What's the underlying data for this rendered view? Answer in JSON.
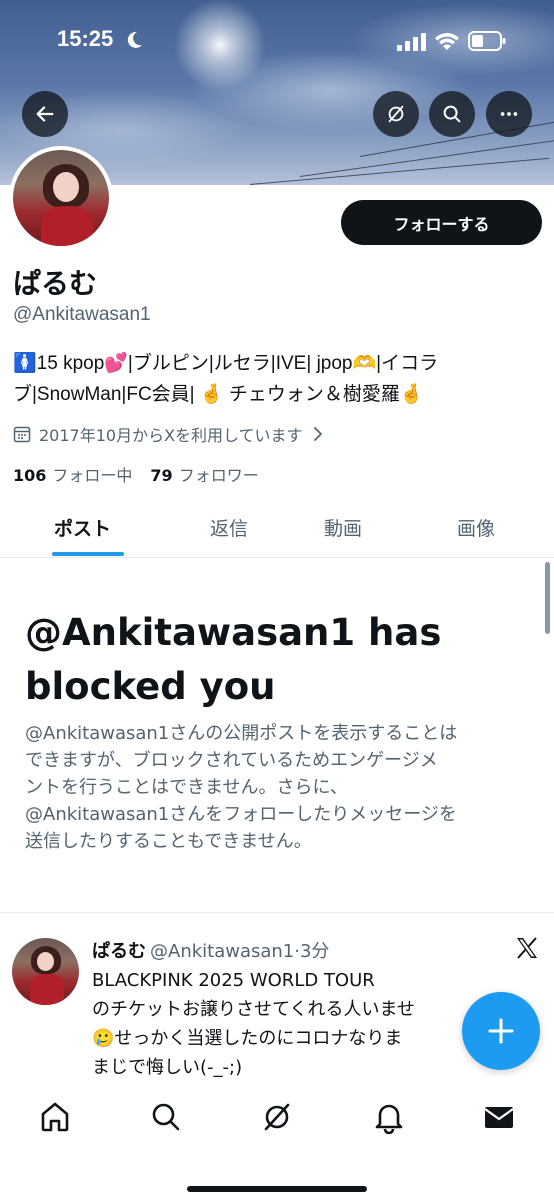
{
  "status_bar": {
    "time": "15:25"
  },
  "profile": {
    "name": "ぱるむ",
    "handle": "@Ankitawasan1",
    "follow_label": "フォローする",
    "bio_lines": [
      "🚺15 kpop💕|ブルピン|ルセラ|IVE| jpop🫶|イコラ",
      "ブ|SnowMan|FC会員| 🤞 チェウォン＆樹愛羅🤞"
    ],
    "joined": "2017年10月からXを利用しています",
    "following_count": "106",
    "following_label": "フォロー中",
    "followers_count": "79",
    "followers_label": "フォロワー"
  },
  "tabs": [
    {
      "label": "ポスト",
      "active": true
    },
    {
      "label": "返信",
      "active": false
    },
    {
      "label": "動画",
      "active": false
    },
    {
      "label": "画像",
      "active": false
    }
  ],
  "blocked": {
    "title": "@Ankitawasan1 has blocked you",
    "body_lines": [
      "@Ankitawasan1さんの公開ポストを表示することは",
      "できますが、ブロックされているためエンゲージメ",
      "ントを行うことはできません。さらに、",
      "@Ankitawasan1さんをフォローしたりメッセージを",
      "送信したりすることもできません。"
    ]
  },
  "post": {
    "author_name": "ぱるむ",
    "author_meta": "@Ankitawasan1·3分",
    "text_lines": [
      "BLACKPINK 2025 WORLD TOUR",
      "のチケットお譲りさせてくれる人いませ",
      "🥲せっかく当選したのにコロナなりま",
      "まじで悔しい(-_-;)"
    ]
  },
  "colors": {
    "accent": "#1d9bf0",
    "text_primary": "#0f1419",
    "text_secondary": "#536471"
  },
  "icons": {
    "back": "arrow-left-icon",
    "grok": "grok-icon",
    "search": "search-icon",
    "more": "more-icon",
    "calendar": "calendar-icon",
    "compose": "plus-icon",
    "nav": [
      "home-icon",
      "search-icon",
      "grok-icon",
      "bell-icon",
      "mail-icon"
    ]
  }
}
